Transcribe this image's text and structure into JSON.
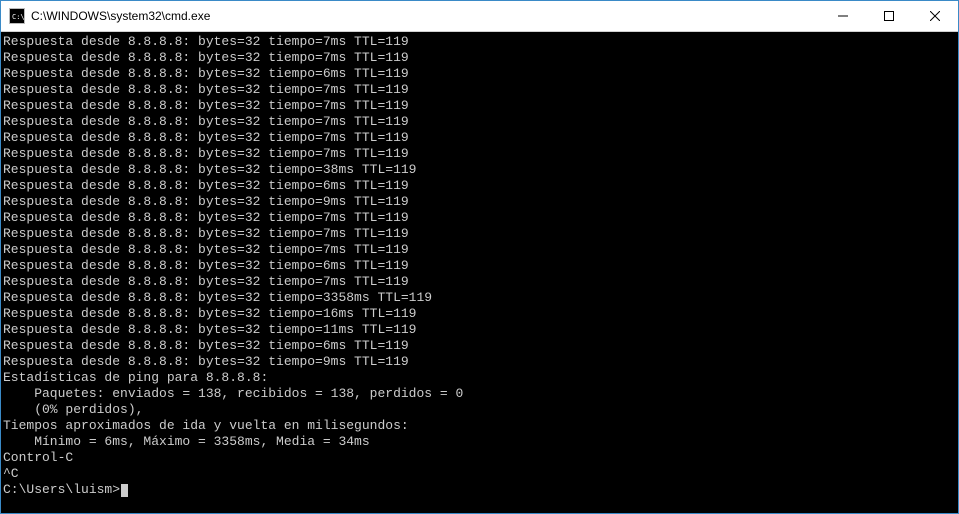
{
  "window": {
    "title": "C:\\WINDOWS\\system32\\cmd.exe"
  },
  "ping": {
    "host": "8.8.8.8",
    "bytes": 32,
    "ttl": 119,
    "replies_ms": [
      7,
      7,
      6,
      7,
      7,
      7,
      7,
      7,
      38,
      6,
      9,
      7,
      7,
      7,
      6,
      7,
      3358,
      16,
      11,
      6,
      9
    ],
    "stats_header": "Estadísticas de ping para 8.8.8.8:",
    "packets": {
      "sent": 138,
      "received": 138,
      "lost": 0,
      "lost_pct": 0
    },
    "rtt": {
      "min_ms": 6,
      "max_ms": 3358,
      "avg_ms": 34
    }
  },
  "tail": {
    "ctrl_c": "Control-C",
    "caret_c": "^C",
    "prompt": "C:\\Users\\luism>"
  },
  "labels": {
    "reply_prefix": "Respuesta desde",
    "bytes_label": "bytes",
    "time_label": "tiempo",
    "ttl_label": "TTL",
    "packets_line_tpl": "    Paquetes: enviados = {sent}, recibidos = {received}, perdidos = {lost}",
    "lost_line_tpl": "    ({pct}% perdidos),",
    "rtt_header": "Tiempos aproximados de ida y vuelta en milisegundos:",
    "rtt_line_tpl": "    Mínimo = {min}ms, Máximo = {max}ms, Media = {avg}ms"
  }
}
